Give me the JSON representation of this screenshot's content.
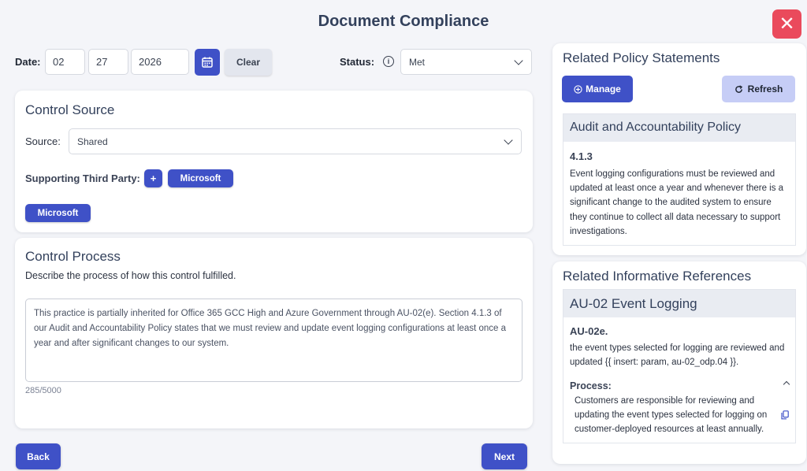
{
  "header": {
    "title": "Document Compliance",
    "close_label": "✕"
  },
  "date": {
    "label": "Date:",
    "month": "02",
    "day": "27",
    "year": "2026",
    "clear_label": "Clear"
  },
  "status": {
    "label": "Status:",
    "info_glyph": "i",
    "value": "Met"
  },
  "control_source": {
    "title": "Control Source",
    "source_label": "Source:",
    "source_value": "Shared",
    "third_party_label": "Supporting Third Party:",
    "add_glyph": "+",
    "third_party_tag": "Microsoft",
    "selected_tag": "Microsoft"
  },
  "control_process": {
    "title": "Control Process",
    "description": "Describe the process of how this control fulfilled.",
    "text": "This practice is partially inherited for Office 365 GCC High and Azure Government through AU-02(e). Section 4.1.3 of our Audit and Accountability Policy states that we must review and update event logging configurations at least once a year and after significant changes to our system.",
    "counter": "285/5000"
  },
  "nav": {
    "back_label": "Back",
    "next_label": "Next"
  },
  "policy": {
    "title": "Related Policy Statements",
    "manage_label": "Manage",
    "refresh_label": "Refresh",
    "name": "Audit and Accountability Policy",
    "number": "4.1.3",
    "text": "Event logging configurations must be reviewed and updated at least once a year and whenever there is a significant change to the audited system to ensure they continue to collect all data necessary to support investigations."
  },
  "references": {
    "title": "Related Informative References",
    "name": "AU-02 Event Logging",
    "id": "AU-02e.",
    "text": "the event types selected for logging are reviewed and updated {{ insert: param, au-02_odp.04 }}.",
    "process_label": "Process:",
    "process_text": "Customers are responsible for reviewing and updating the event types selected for logging on customer-deployed resources at least annually."
  },
  "colors": {
    "primary": "#3f51c7",
    "danger": "#ea4a5c",
    "secondary": "#c6cdf6"
  }
}
